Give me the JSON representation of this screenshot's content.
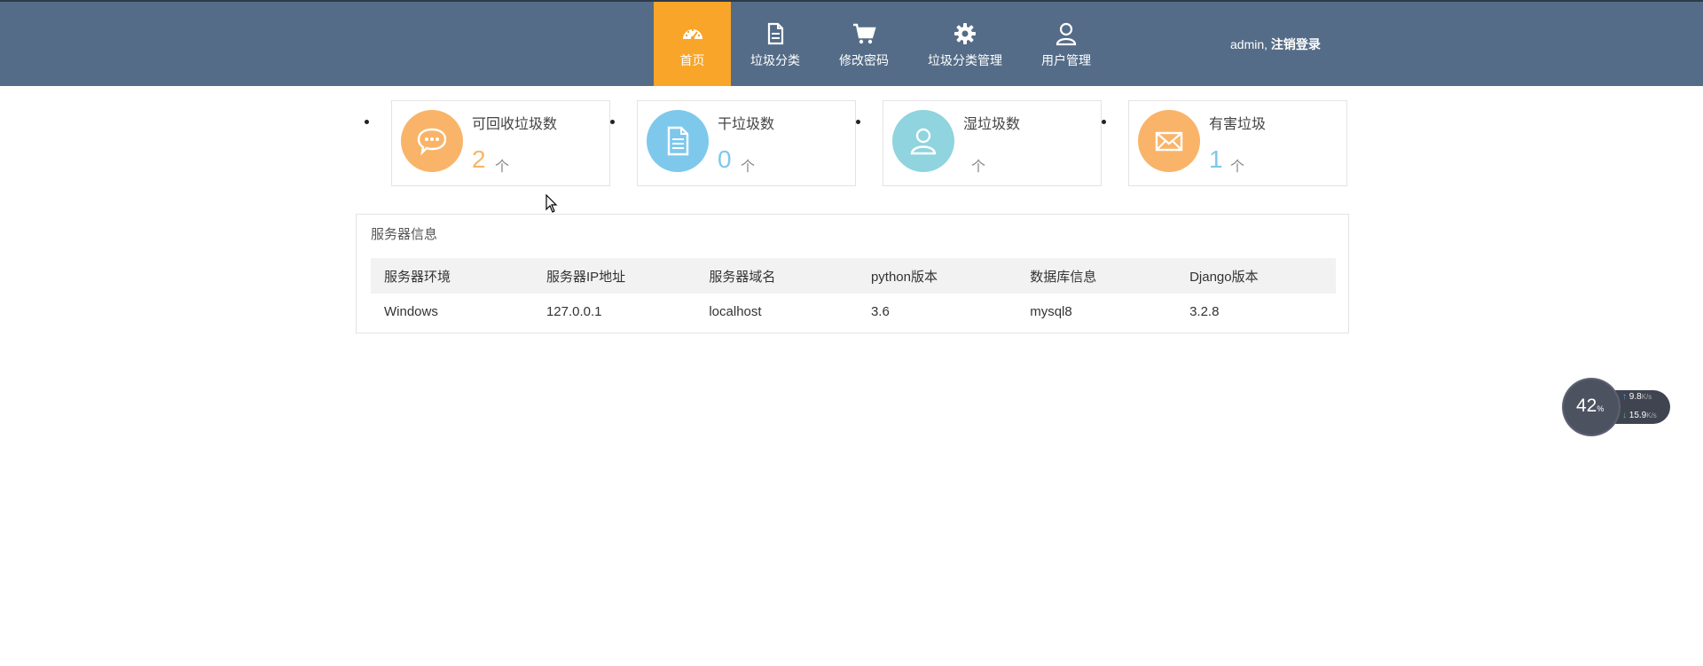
{
  "nav": {
    "items": [
      {
        "label": "首页",
        "icon": "dashboard-icon",
        "active": true
      },
      {
        "label": "垃圾分类",
        "icon": "document-icon",
        "active": false
      },
      {
        "label": "修改密码",
        "icon": "cart-icon",
        "active": false
      },
      {
        "label": "垃圾分类管理",
        "icon": "gear-icon",
        "active": false
      },
      {
        "label": "用户管理",
        "icon": "user-icon",
        "active": false
      }
    ],
    "user": "admin,",
    "logout": "注销登录"
  },
  "stats": [
    {
      "title": "可回收垃圾数",
      "value": "2",
      "unit": "个",
      "color": "#f9b469",
      "icon": "chat-bubble-icon"
    },
    {
      "title": "干垃圾数",
      "value": "0",
      "unit": "个",
      "color": "#7ec8ec",
      "icon": "document-icon"
    },
    {
      "title": "湿垃圾数",
      "value": "",
      "unit": "个",
      "color": "#8fd4de",
      "icon": "user-icon"
    },
    {
      "title": "有害垃圾",
      "value": "1",
      "unit": "个",
      "color": "#f9b469",
      "icon": "mail-icon"
    }
  ],
  "server": {
    "title": "服务器信息",
    "columns": [
      "服务器环境",
      "服务器IP地址",
      "服务器域名",
      "python版本",
      "数据库信息",
      "Django版本"
    ],
    "row": [
      "Windows",
      "127.0.0.1",
      "localhost",
      "3.6",
      "mysql8",
      "3.2.8"
    ]
  },
  "net_widget": {
    "percent": "42",
    "percent_unit": "%",
    "up": "9.8",
    "down": "15.9",
    "unit": "K/s"
  },
  "colors": {
    "topbar": "#546c87",
    "accent": "#f9a52a"
  }
}
